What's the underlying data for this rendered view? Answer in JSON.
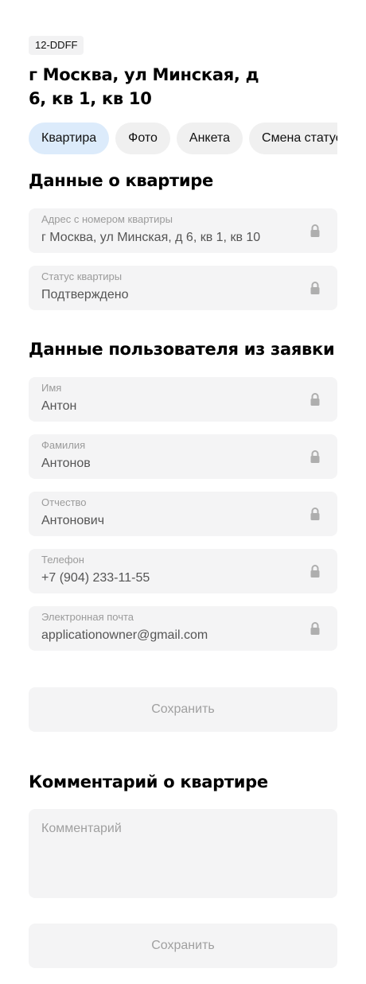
{
  "header": {
    "code": "12-DDFF",
    "title": "г Москва, ул Минская, д 6, кв 1, кв 10"
  },
  "tabs": [
    {
      "label": "Квартира",
      "active": true
    },
    {
      "label": "Фото",
      "active": false
    },
    {
      "label": "Анкета",
      "active": false
    },
    {
      "label": "Смена статуса",
      "active": false
    }
  ],
  "apartment": {
    "heading": "Данные о квартире",
    "address_label": "Адрес с номером квартиры",
    "address_value": "г Москва, ул Минская, д 6, кв 1, кв 10",
    "status_label": "Статус квартиры",
    "status_value": "Подтверждено"
  },
  "user": {
    "heading": "Данные пользователя из заявки",
    "first_name_label": "Имя",
    "first_name_value": "Антон",
    "last_name_label": "Фамилия",
    "last_name_value": "Антонов",
    "patronymic_label": "Отчество",
    "patronymic_value": "Антонович",
    "phone_label": "Телефон",
    "phone_value": "+7 (904) 233-11-55",
    "email_label": "Электронная почта",
    "email_value": "applicationowner@gmail.com",
    "save_label": "Сохранить"
  },
  "comment": {
    "heading": "Комментарий о квартире",
    "placeholder": "Комментарий",
    "save_label": "Сохранить"
  },
  "icons": {
    "lock": "lock-icon"
  },
  "colors": {
    "active_tab": "#dcebfb",
    "field_bg": "#f4f4f5",
    "label": "#9b9b9b"
  }
}
